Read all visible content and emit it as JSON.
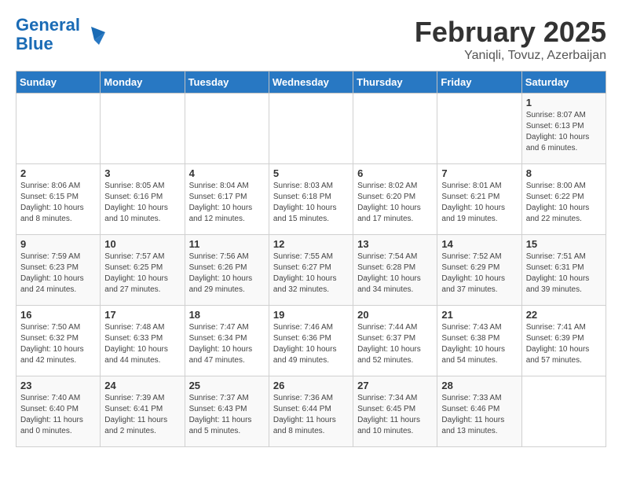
{
  "logo": {
    "line1": "General",
    "line2": "Blue"
  },
  "title": "February 2025",
  "subtitle": "Yaniqli, Tovuz, Azerbaijan",
  "days_of_week": [
    "Sunday",
    "Monday",
    "Tuesday",
    "Wednesday",
    "Thursday",
    "Friday",
    "Saturday"
  ],
  "weeks": [
    [
      {
        "day": "",
        "info": ""
      },
      {
        "day": "",
        "info": ""
      },
      {
        "day": "",
        "info": ""
      },
      {
        "day": "",
        "info": ""
      },
      {
        "day": "",
        "info": ""
      },
      {
        "day": "",
        "info": ""
      },
      {
        "day": "1",
        "info": "Sunrise: 8:07 AM\nSunset: 6:13 PM\nDaylight: 10 hours and 6 minutes."
      }
    ],
    [
      {
        "day": "2",
        "info": "Sunrise: 8:06 AM\nSunset: 6:15 PM\nDaylight: 10 hours and 8 minutes."
      },
      {
        "day": "3",
        "info": "Sunrise: 8:05 AM\nSunset: 6:16 PM\nDaylight: 10 hours and 10 minutes."
      },
      {
        "day": "4",
        "info": "Sunrise: 8:04 AM\nSunset: 6:17 PM\nDaylight: 10 hours and 12 minutes."
      },
      {
        "day": "5",
        "info": "Sunrise: 8:03 AM\nSunset: 6:18 PM\nDaylight: 10 hours and 15 minutes."
      },
      {
        "day": "6",
        "info": "Sunrise: 8:02 AM\nSunset: 6:20 PM\nDaylight: 10 hours and 17 minutes."
      },
      {
        "day": "7",
        "info": "Sunrise: 8:01 AM\nSunset: 6:21 PM\nDaylight: 10 hours and 19 minutes."
      },
      {
        "day": "8",
        "info": "Sunrise: 8:00 AM\nSunset: 6:22 PM\nDaylight: 10 hours and 22 minutes."
      }
    ],
    [
      {
        "day": "9",
        "info": "Sunrise: 7:59 AM\nSunset: 6:23 PM\nDaylight: 10 hours and 24 minutes."
      },
      {
        "day": "10",
        "info": "Sunrise: 7:57 AM\nSunset: 6:25 PM\nDaylight: 10 hours and 27 minutes."
      },
      {
        "day": "11",
        "info": "Sunrise: 7:56 AM\nSunset: 6:26 PM\nDaylight: 10 hours and 29 minutes."
      },
      {
        "day": "12",
        "info": "Sunrise: 7:55 AM\nSunset: 6:27 PM\nDaylight: 10 hours and 32 minutes."
      },
      {
        "day": "13",
        "info": "Sunrise: 7:54 AM\nSunset: 6:28 PM\nDaylight: 10 hours and 34 minutes."
      },
      {
        "day": "14",
        "info": "Sunrise: 7:52 AM\nSunset: 6:29 PM\nDaylight: 10 hours and 37 minutes."
      },
      {
        "day": "15",
        "info": "Sunrise: 7:51 AM\nSunset: 6:31 PM\nDaylight: 10 hours and 39 minutes."
      }
    ],
    [
      {
        "day": "16",
        "info": "Sunrise: 7:50 AM\nSunset: 6:32 PM\nDaylight: 10 hours and 42 minutes."
      },
      {
        "day": "17",
        "info": "Sunrise: 7:48 AM\nSunset: 6:33 PM\nDaylight: 10 hours and 44 minutes."
      },
      {
        "day": "18",
        "info": "Sunrise: 7:47 AM\nSunset: 6:34 PM\nDaylight: 10 hours and 47 minutes."
      },
      {
        "day": "19",
        "info": "Sunrise: 7:46 AM\nSunset: 6:36 PM\nDaylight: 10 hours and 49 minutes."
      },
      {
        "day": "20",
        "info": "Sunrise: 7:44 AM\nSunset: 6:37 PM\nDaylight: 10 hours and 52 minutes."
      },
      {
        "day": "21",
        "info": "Sunrise: 7:43 AM\nSunset: 6:38 PM\nDaylight: 10 hours and 54 minutes."
      },
      {
        "day": "22",
        "info": "Sunrise: 7:41 AM\nSunset: 6:39 PM\nDaylight: 10 hours and 57 minutes."
      }
    ],
    [
      {
        "day": "23",
        "info": "Sunrise: 7:40 AM\nSunset: 6:40 PM\nDaylight: 11 hours and 0 minutes."
      },
      {
        "day": "24",
        "info": "Sunrise: 7:39 AM\nSunset: 6:41 PM\nDaylight: 11 hours and 2 minutes."
      },
      {
        "day": "25",
        "info": "Sunrise: 7:37 AM\nSunset: 6:43 PM\nDaylight: 11 hours and 5 minutes."
      },
      {
        "day": "26",
        "info": "Sunrise: 7:36 AM\nSunset: 6:44 PM\nDaylight: 11 hours and 8 minutes."
      },
      {
        "day": "27",
        "info": "Sunrise: 7:34 AM\nSunset: 6:45 PM\nDaylight: 11 hours and 10 minutes."
      },
      {
        "day": "28",
        "info": "Sunrise: 7:33 AM\nSunset: 6:46 PM\nDaylight: 11 hours and 13 minutes."
      },
      {
        "day": "",
        "info": ""
      }
    ]
  ]
}
